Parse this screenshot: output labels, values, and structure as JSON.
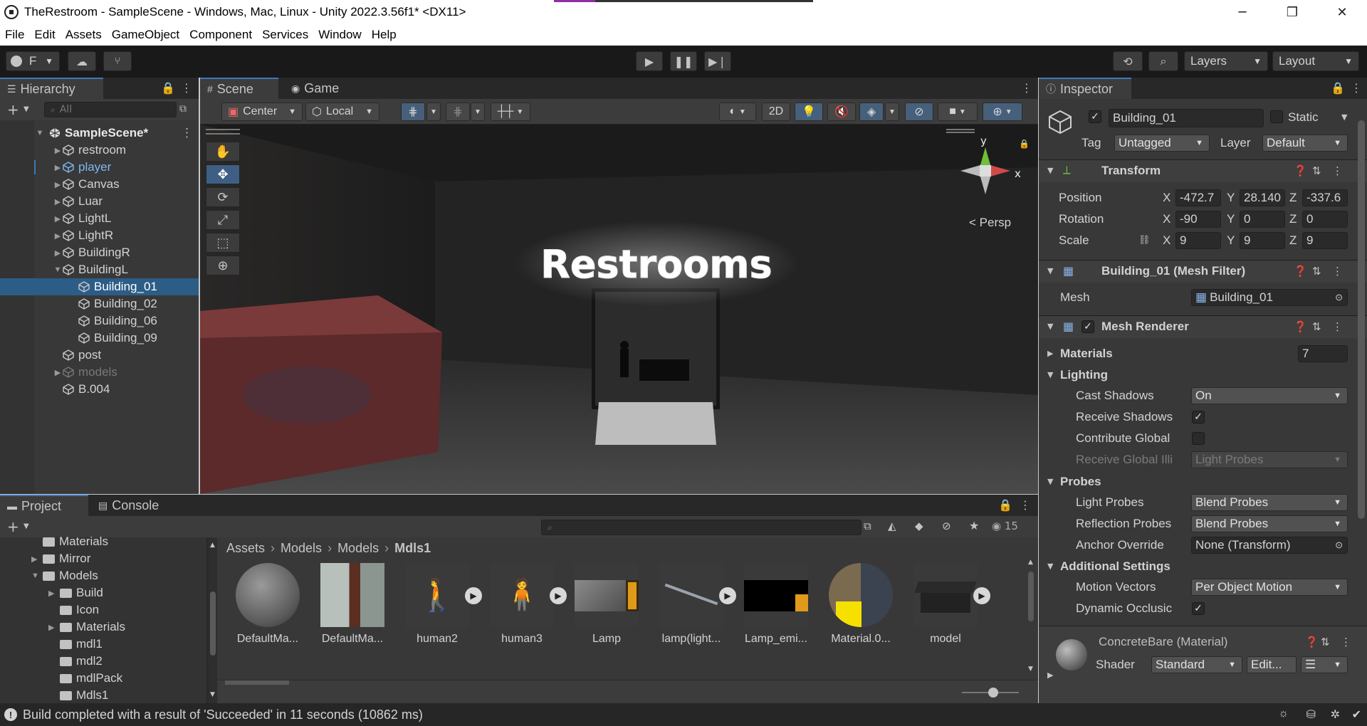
{
  "window": {
    "title": "TheRestroom - SampleScene - Windows, Mac, Linux - Unity 2022.3.56f1* <DX11>",
    "minimize": "─",
    "maximize": "❐",
    "close": "✕",
    "progress": 0.16,
    "progress_color": "#8f2ea8"
  },
  "menu": [
    "File",
    "Edit",
    "Assets",
    "GameObject",
    "Component",
    "Services",
    "Window",
    "Help"
  ],
  "toolbar": {
    "account_label": "F",
    "layers_label": "Layers",
    "layout_label": "Layout"
  },
  "hierarchy": {
    "tab_label": "Hierarchy",
    "search_placeholder": "All",
    "scene_name": "SampleScene*",
    "items": [
      {
        "label": "restroom",
        "indent": 1,
        "fold": "▶",
        "style": "normal"
      },
      {
        "label": "player",
        "indent": 1,
        "fold": "▶",
        "style": "prefab"
      },
      {
        "label": "Canvas",
        "indent": 1,
        "fold": "▶",
        "style": "normal"
      },
      {
        "label": "Luar",
        "indent": 1,
        "fold": "▶",
        "style": "normal"
      },
      {
        "label": "LightL",
        "indent": 1,
        "fold": "▶",
        "style": "normal"
      },
      {
        "label": "LightR",
        "indent": 1,
        "fold": "▶",
        "style": "normal"
      },
      {
        "label": "BuildingR",
        "indent": 1,
        "fold": "▶",
        "style": "normal"
      },
      {
        "label": "BuildingL",
        "indent": 1,
        "fold": "▼",
        "style": "normal"
      },
      {
        "label": "Building_01",
        "indent": 2,
        "fold": "",
        "style": "selected"
      },
      {
        "label": "Building_02",
        "indent": 2,
        "fold": "",
        "style": "normal"
      },
      {
        "label": "Building_06",
        "indent": 2,
        "fold": "",
        "style": "normal"
      },
      {
        "label": "Building_09",
        "indent": 2,
        "fold": "",
        "style": "normal"
      },
      {
        "label": "post",
        "indent": 1,
        "fold": "",
        "style": "normal"
      },
      {
        "label": "models",
        "indent": 1,
        "fold": "▶",
        "style": "disabled"
      },
      {
        "label": "B.004",
        "indent": 1,
        "fold": "",
        "style": "normal"
      }
    ]
  },
  "scene": {
    "tab_scene": "Scene",
    "tab_game": "Game",
    "pivot_label": "Center",
    "space_label": "Local",
    "mode_2d": "2D",
    "sign_text": "Restrooms",
    "persp_label": "Persp",
    "axis_y": "y",
    "axis_x": "x"
  },
  "inspector": {
    "tab_label": "Inspector",
    "object_name": "Building_01",
    "static_label": "Static",
    "tag_label": "Tag",
    "tag_value": "Untagged",
    "layer_label": "Layer",
    "layer_value": "Default",
    "transform": {
      "header": "Transform",
      "position_label": "Position",
      "rotation_label": "Rotation",
      "scale_label": "Scale",
      "axis_x": "X",
      "axis_y": "Y",
      "axis_z": "Z",
      "position": [
        "-472.7",
        "28.140",
        "-337.6"
      ],
      "rotation": [
        "-90",
        "0",
        "0"
      ],
      "scale": [
        "9",
        "9",
        "9"
      ]
    },
    "mesh_filter": {
      "header": "Building_01 (Mesh Filter)",
      "mesh_label": "Mesh",
      "mesh_value": "Building_01"
    },
    "mesh_renderer": {
      "header": "Mesh Renderer",
      "materials_label": "Materials",
      "materials_count": "7",
      "lighting_label": "Lighting",
      "cast_shadows_label": "Cast Shadows",
      "cast_shadows_value": "On",
      "receive_shadows_label": "Receive Shadows",
      "contribute_gi_label": "Contribute Global",
      "receive_gi_label": "Receive Global Illi",
      "receive_gi_value": "Light Probes",
      "probes_label": "Probes",
      "light_probes_label": "Light Probes",
      "light_probes_value": "Blend Probes",
      "reflection_probes_label": "Reflection Probes",
      "reflection_probes_value": "Blend Probes",
      "anchor_override_label": "Anchor Override",
      "anchor_override_value": "None (Transform)",
      "additional_label": "Additional Settings",
      "motion_vectors_label": "Motion Vectors",
      "motion_vectors_value": "Per Object Motion",
      "dynamic_occlusion_label": "Dynamic Occlusic"
    },
    "material": {
      "name": "ConcreteBare (Material)",
      "shader_label": "Shader",
      "shader_value": "Standard",
      "edit_label": "Edit..."
    }
  },
  "project": {
    "tab_project": "Project",
    "tab_console": "Console",
    "hidden_count": "15",
    "tree": [
      {
        "label": "Materials",
        "indent": 0,
        "fold": ""
      },
      {
        "label": "Mirror",
        "indent": 0,
        "fold": "▶"
      },
      {
        "label": "Models",
        "indent": 0,
        "fold": "▼"
      },
      {
        "label": "Build",
        "indent": 1,
        "fold": "▶"
      },
      {
        "label": "Icon",
        "indent": 1,
        "fold": ""
      },
      {
        "label": "Materials",
        "indent": 1,
        "fold": "▶"
      },
      {
        "label": "mdl1",
        "indent": 1,
        "fold": ""
      },
      {
        "label": "mdl2",
        "indent": 1,
        "fold": ""
      },
      {
        "label": "mdlPack",
        "indent": 1,
        "fold": ""
      },
      {
        "label": "Mdls1",
        "indent": 1,
        "fold": ""
      }
    ],
    "breadcrumb": [
      "Assets",
      "Models",
      "Models",
      "Mdls1"
    ],
    "assets": [
      {
        "name": "DefaultMa...",
        "kind": "material-sphere",
        "badge": false
      },
      {
        "name": "DefaultMa...",
        "kind": "texture",
        "badge": false
      },
      {
        "name": "human2",
        "kind": "model-human",
        "badge": true
      },
      {
        "name": "human3",
        "kind": "model-human-sit",
        "badge": true
      },
      {
        "name": "Lamp",
        "kind": "lamp",
        "badge": false
      },
      {
        "name": "lamp(light...",
        "kind": "model-lamp",
        "badge": true
      },
      {
        "name": "Lamp_emi...",
        "kind": "emission",
        "badge": false
      },
      {
        "name": "Material.0...",
        "kind": "material-yellow",
        "badge": false
      },
      {
        "name": "model",
        "kind": "model-desk",
        "badge": true
      }
    ]
  },
  "status": {
    "message": "Build completed with a result of 'Succeeded' in 11 seconds (10862 ms)"
  },
  "colors": {
    "selection": "#2c5d87",
    "accent": "#3a79bb",
    "prefab_text": "#7fb6f5",
    "panel_bg": "#383838"
  }
}
